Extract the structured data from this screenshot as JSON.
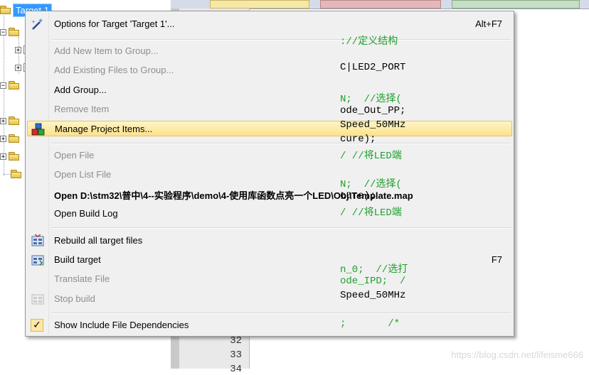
{
  "tree": {
    "root_label": "Target 1",
    "expand_symbol": "+"
  },
  "editor": {
    "line_numbers": [
      "32",
      "33",
      "34"
    ],
    "code_lines": [
      {
        "text": "://定义结构",
        "comment": true
      },
      {
        "text": "C|LED2_PORT",
        "comment": false
      },
      {
        "text": "N;  //选择(",
        "comment": true
      },
      {
        "text": "ode_Out_PP;",
        "comment": false
      },
      {
        "text": "Speed_50MHz",
        "comment": false
      },
      {
        "text": "cure);",
        "comment": false
      },
      {
        "text": "/ //将LED端",
        "comment": true
      },
      {
        "text": "N;  //选择(",
        "comment": true
      },
      {
        "text": "cure);",
        "comment": false
      },
      {
        "text": "/ //将LED端",
        "comment": true
      },
      {
        "text": "n_0;  //选打",
        "comment": true
      },
      {
        "text": "ode_IPD;  /",
        "comment": true
      },
      {
        "text": "Speed_50MHz",
        "comment": false
      },
      {
        "text": ";       /*",
        "comment": true
      }
    ],
    "watermark": "https://blog.csdn.net/lifeisme666"
  },
  "menu": {
    "items": [
      {
        "label": "Options for Target 'Target 1'...",
        "shortcut": "Alt+F7",
        "icon": "magic-wand-icon",
        "state": "enabled"
      },
      {
        "label": "Add New Item to Group...",
        "shortcut": "",
        "icon": "",
        "state": "disabled"
      },
      {
        "label": "Add Existing Files to Group...",
        "shortcut": "",
        "icon": "",
        "state": "disabled"
      },
      {
        "label": "Add Group...",
        "shortcut": "",
        "icon": "",
        "state": "enabled"
      },
      {
        "label": "Remove Item",
        "shortcut": "",
        "icon": "",
        "state": "disabled"
      },
      {
        "label": "Manage Project Items...",
        "shortcut": "",
        "icon": "colored-blocks-icon",
        "state": "highlighted"
      },
      {
        "label": "Open File",
        "shortcut": "",
        "icon": "",
        "state": "disabled"
      },
      {
        "label": "Open List File",
        "shortcut": "",
        "icon": "",
        "state": "disabled"
      },
      {
        "label": "Open D:\\stm32\\普中\\4--实验程序\\demo\\4-使用库函数点亮一个LED\\Obj\\Template.map",
        "shortcut": "",
        "icon": "",
        "state": "bold"
      },
      {
        "label": "Open Build Log",
        "shortcut": "",
        "icon": "",
        "state": "enabled"
      },
      {
        "label": "Rebuild all target files",
        "shortcut": "",
        "icon": "rebuild-icon",
        "state": "enabled"
      },
      {
        "label": "Build target",
        "shortcut": "F7",
        "icon": "build-icon",
        "state": "enabled"
      },
      {
        "label": "Translate File",
        "shortcut": "",
        "icon": "",
        "state": "disabled"
      },
      {
        "label": "Stop build",
        "shortcut": "",
        "icon": "stop-build-icon",
        "state": "disabled"
      },
      {
        "label": "Show Include File Dependencies",
        "shortcut": "",
        "icon": "checkmark-icon",
        "state": "checked"
      }
    ],
    "checkmark_glyph": "✓"
  }
}
